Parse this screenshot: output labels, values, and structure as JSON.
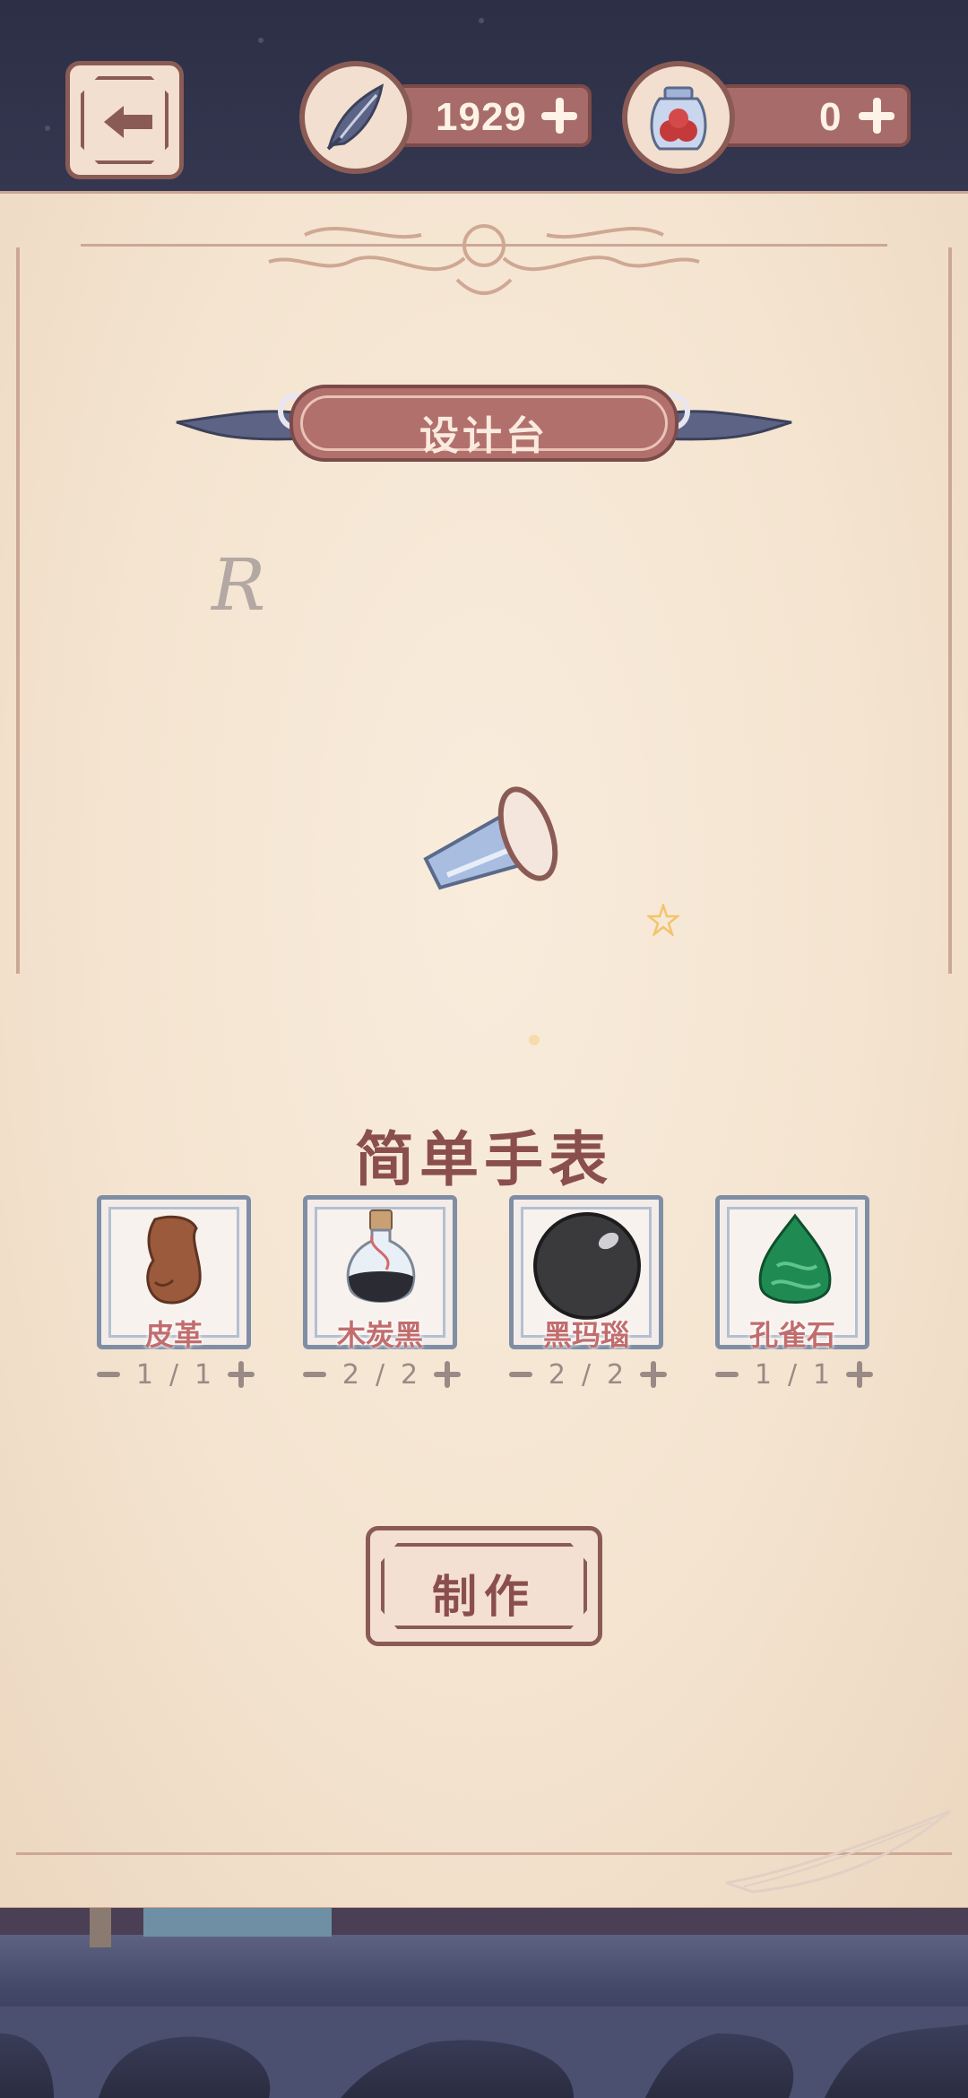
{
  "header": {
    "feather_currency": {
      "value": "1929",
      "icon": "feather-icon"
    },
    "jar_currency": {
      "value": "0",
      "icon": "berry-jar-icon"
    }
  },
  "panel": {
    "title": "设计台",
    "ornament_letter": "R"
  },
  "item": {
    "name": "简单手表"
  },
  "materials": [
    {
      "name": "皮革",
      "have": "1",
      "need": "1",
      "icon": "leather-pouch-icon"
    },
    {
      "name": "木炭黑",
      "have": "2",
      "need": "2",
      "icon": "ink-bottle-icon"
    },
    {
      "name": "黑玛瑙",
      "have": "2",
      "need": "2",
      "icon": "black-orb-icon"
    },
    {
      "name": "孔雀石",
      "have": "1",
      "need": "1",
      "icon": "malachite-gem-icon"
    }
  ],
  "actions": {
    "craft_label": "制作"
  },
  "colors": {
    "frame": "#8a5b55",
    "banner": "#b1706c",
    "parchment": "#f4e4d0",
    "accent_text": "#8a4f4c"
  }
}
